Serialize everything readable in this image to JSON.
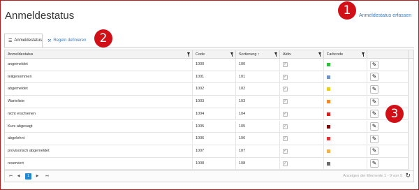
{
  "title": "Anmeldestatus",
  "add_link": "Anmeldestatus erfassen",
  "tabs": [
    {
      "label": "Anmeldestatus",
      "icon": "list-icon"
    },
    {
      "label": "Regeln definieren",
      "icon": "rules-icon"
    }
  ],
  "columns": [
    "Anmeldestatus",
    "Code",
    "Sortierung ↑",
    "Aktiv",
    "Farbcode"
  ],
  "rows": [
    {
      "name": "angemeldet",
      "code": "1000",
      "sort": "100",
      "color": "#2fbf3a"
    },
    {
      "name": "teilgenommen",
      "code": "1001",
      "sort": "101",
      "color": "#6f93c9"
    },
    {
      "name": "abgemeldet",
      "code": "1002",
      "sort": "102",
      "color": "#e7cf1c"
    },
    {
      "name": "Warteliste",
      "code": "1003",
      "sort": "103",
      "color": "#f08a24"
    },
    {
      "name": "nicht erschienen",
      "code": "1004",
      "sort": "104",
      "color": "#d81e1e"
    },
    {
      "name": "Kurs abgesagt",
      "code": "1005",
      "sort": "105",
      "color": "#7a0c0c"
    },
    {
      "name": "abgelehnt",
      "code": "1006",
      "sort": "106",
      "color": "#e53232"
    },
    {
      "name": "provisorisch abgemeldet",
      "code": "1007",
      "sort": "107",
      "color": "#f6b04b"
    },
    {
      "name": "reserviert",
      "code": "1008",
      "sort": "108",
      "color": "#6a6a6a"
    }
  ],
  "pager": {
    "first": "⏮",
    "prev": "◀",
    "page": "1",
    "next": "▶",
    "last": "⏭",
    "info": "Anzeigen der Elemente 1 - 9 von 9"
  },
  "markers": [
    "1",
    "2",
    "3"
  ]
}
